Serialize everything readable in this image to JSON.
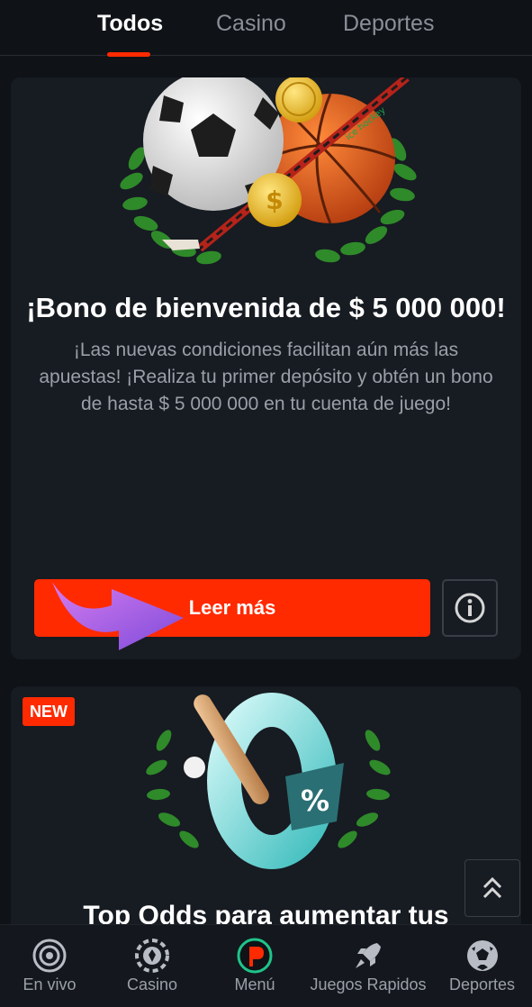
{
  "tabs": [
    {
      "label": "Todos",
      "active": true
    },
    {
      "label": "Casino",
      "active": false
    },
    {
      "label": "Deportes",
      "active": false
    }
  ],
  "promo1": {
    "title": "¡Bono de bienvenida de $ 5 000 000!",
    "description": "¡Las nuevas condiciones facilitan aún más las apuestas! ¡Realiza tu primer depósito y obtén un bono de hasta $ 5 000 000 en tu cuenta de juego!",
    "read_more_label": "Leer más",
    "hockey_stick_text": "ice hockey"
  },
  "promo2": {
    "badge": "NEW",
    "title": "Top Odds para aumentar tus"
  },
  "bottom_nav": [
    {
      "label": "En vivo",
      "icon": "live-icon"
    },
    {
      "label": "Casino",
      "icon": "casino-chip-icon"
    },
    {
      "label": "Menú",
      "icon": "brand-logo-icon"
    },
    {
      "label": "Juegos Rapidos",
      "icon": "rocket-icon"
    },
    {
      "label": "Deportes",
      "icon": "soccer-ball-icon"
    }
  ],
  "colors": {
    "accent": "#ff2a00",
    "background": "#0f1217",
    "card": "#171b22",
    "muted_text": "#9aa0a8"
  }
}
